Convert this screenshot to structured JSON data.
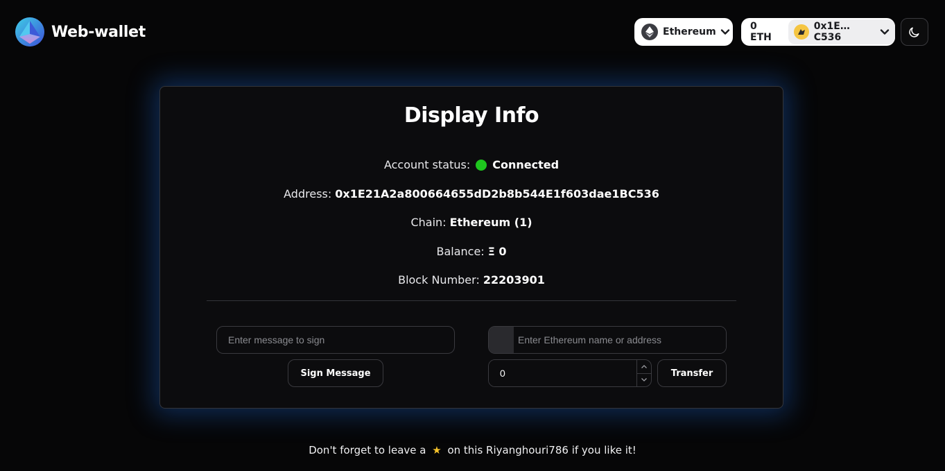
{
  "app": {
    "brand_name": "Web-wallet"
  },
  "header": {
    "network_label": "Ethereum",
    "account_balance": "0 ETH",
    "account_short_address": "0x1E…C536",
    "theme_icon": "moon-icon"
  },
  "card": {
    "title": "Display Info",
    "status_label": "Account status:",
    "status_value": "Connected",
    "status_color": "#1ec51e",
    "address_label": "Address:",
    "address_value": "0x1E21A2a800664655dD2b8b544E1f603dae1BC536",
    "chain_label": "Chain:",
    "chain_value": "Ethereum (1)",
    "balance_label": "Balance:",
    "balance_value": "Ξ 0",
    "block_label": "Block Number:",
    "block_value": "22203901"
  },
  "sign": {
    "message_placeholder": "Enter message to sign",
    "button_label": "Sign Message"
  },
  "transfer": {
    "address_placeholder": "Enter Ethereum name or address",
    "amount_value": "0",
    "button_label": "Transfer"
  },
  "footer": {
    "text_before": "Don't forget to leave a",
    "star": "★",
    "text_link": "on this Riyanghouri786",
    "text_after": "if you like it!"
  },
  "colors": {
    "background": "#060607",
    "card_glow": "#1854aa",
    "accent_star": "#f6c32b"
  }
}
